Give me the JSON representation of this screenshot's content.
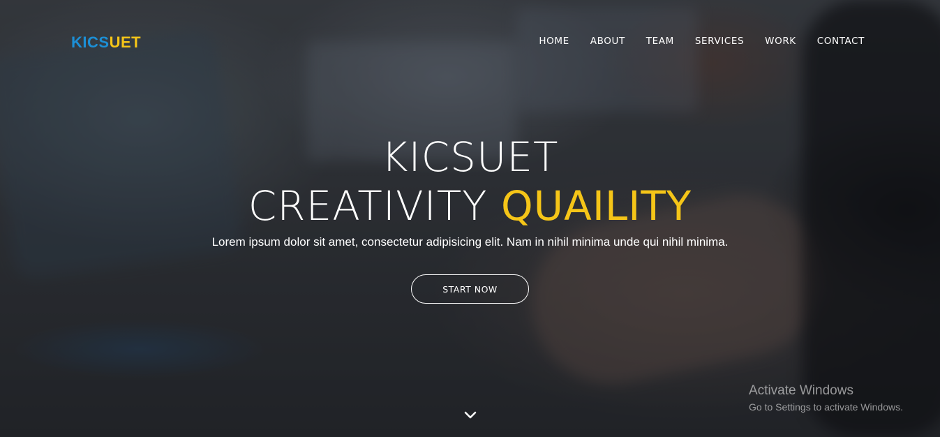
{
  "brand": {
    "logo_part1": "KICS",
    "logo_part2": "UET",
    "colors": {
      "blue": "#1c8fd6",
      "yellow": "#f5c518"
    }
  },
  "nav": {
    "items": [
      {
        "label": "HOME"
      },
      {
        "label": "ABOUT"
      },
      {
        "label": "TEAM"
      },
      {
        "label": "SERVICES"
      },
      {
        "label": "WORK"
      },
      {
        "label": "CONTACT"
      }
    ]
  },
  "hero": {
    "line1": "KICSUET",
    "line2_plain": "CREATIVITY ",
    "line2_accent": "QUAILITY",
    "subtitle": "Lorem ipsum dolor sit amet, consectetur adipisicing elit. Nam in nihil minima unde qui nihil minima.",
    "cta_label": "START NOW",
    "scroll_icon": "chevron-down-icon"
  },
  "windows_watermark": {
    "title": "Activate Windows",
    "subtitle": "Go to Settings to activate Windows."
  }
}
